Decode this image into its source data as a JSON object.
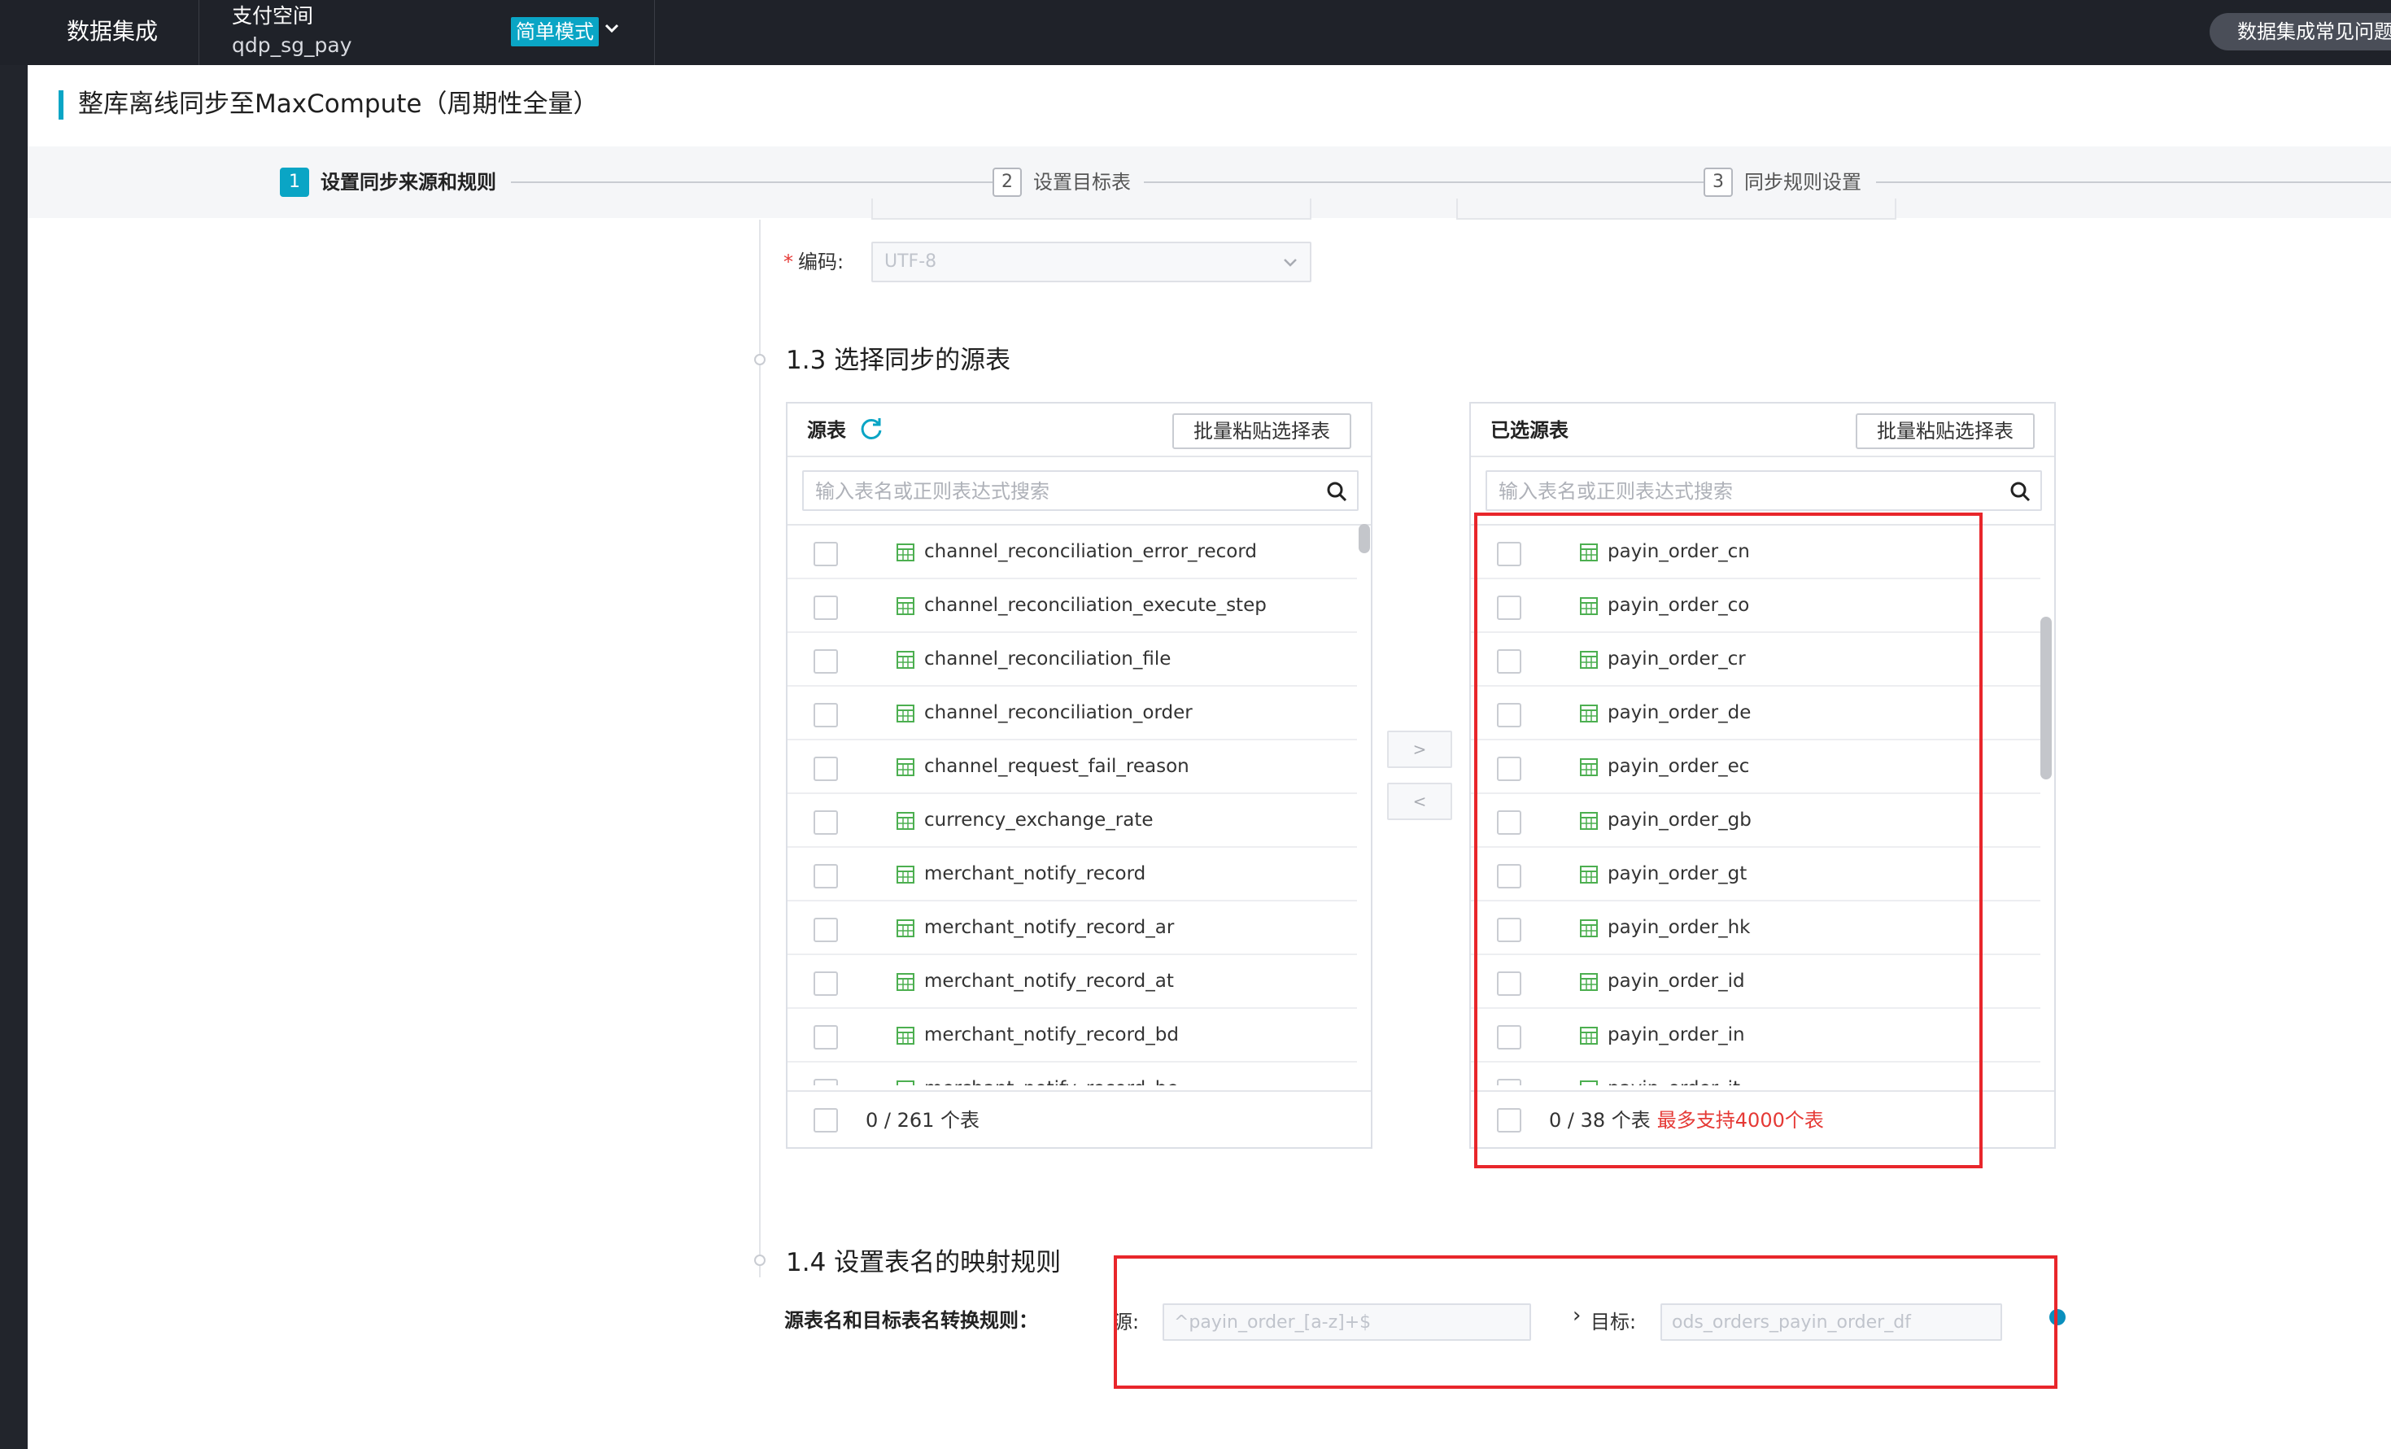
{
  "topbar": {
    "brand": "数据集成",
    "workspace_name": "支付空间",
    "workspace_id": "qdp_sg_pay",
    "mode_label": "简单模式",
    "faq_label": "数据集成常见问题"
  },
  "page": {
    "title": "整库离线同步至MaxCompute（周期性全量）"
  },
  "steps": [
    {
      "num": "1",
      "label": "设置同步来源和规则",
      "active": true
    },
    {
      "num": "2",
      "label": "设置目标表",
      "active": false
    },
    {
      "num": "3",
      "label": "同步规则设置",
      "active": false
    }
  ],
  "encoding": {
    "required_mark": "*",
    "label": "编码:",
    "value": "UTF-8"
  },
  "section_source": {
    "title": "1.3 选择同步的源表"
  },
  "source_panel": {
    "title": "源表",
    "paste_button": "批量粘贴选择表",
    "search_placeholder": "输入表名或正则表达式搜索",
    "rows": [
      "channel_reconciliation_error_record",
      "channel_reconciliation_execute_step",
      "channel_reconciliation_file",
      "channel_reconciliation_order",
      "channel_request_fail_reason",
      "currency_exchange_rate",
      "merchant_notify_record",
      "merchant_notify_record_ar",
      "merchant_notify_record_at",
      "merchant_notify_record_bd",
      "merchant_notify_record_be"
    ],
    "count": "0 / 261 个表"
  },
  "transfer": {
    "move_right": ">",
    "move_left": "<"
  },
  "selected_panel": {
    "title": "已选源表",
    "paste_button": "批量粘贴选择表",
    "search_placeholder": "输入表名或正则表达式搜索",
    "rows": [
      "payin_order_cn",
      "payin_order_co",
      "payin_order_cr",
      "payin_order_de",
      "payin_order_ec",
      "payin_order_gb",
      "payin_order_gt",
      "payin_order_hk",
      "payin_order_id",
      "payin_order_in",
      "payin_order_it"
    ],
    "count": "0 / 38 个表",
    "limit_note": "最多支持4000个表"
  },
  "section_mapping": {
    "title": "1.4 设置表名的映射规则",
    "rule_label": "源表名和目标表名转换规则：",
    "source_label": "源:",
    "source_value": "^payin_order_[a-z]+$",
    "arrow": "›",
    "target_label": "目标:",
    "target_value": "ods_orders_payin_order_df"
  },
  "colors": {
    "accent": "#0aa5c5",
    "highlight": "#e8262b",
    "topbar": "#1f2229",
    "table_icon": "#4caf50"
  }
}
